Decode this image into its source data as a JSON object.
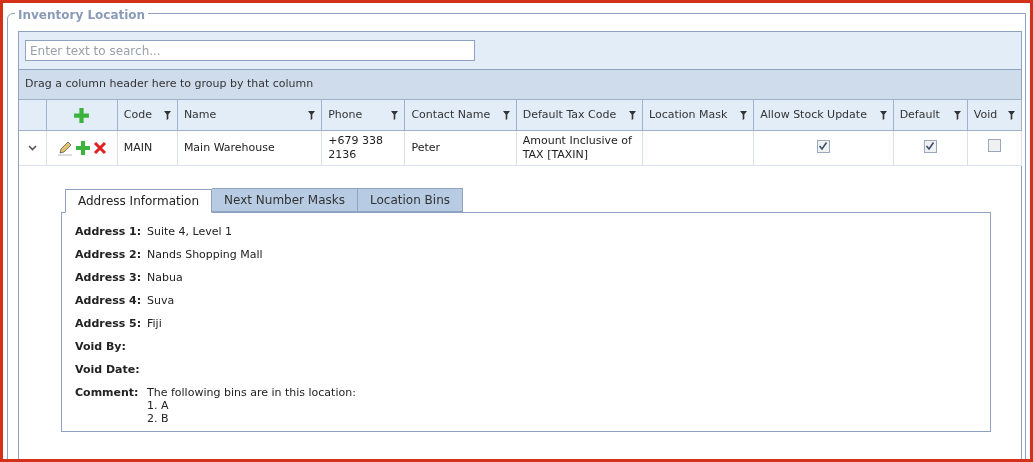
{
  "panel": {
    "title": "Inventory Location"
  },
  "search": {
    "placeholder": "Enter text to search..."
  },
  "group_panel": {
    "text": "Drag a column header here to group by that column"
  },
  "table": {
    "columns": [
      {
        "label": "Code"
      },
      {
        "label": "Name"
      },
      {
        "label": "Phone"
      },
      {
        "label": "Contact Name"
      },
      {
        "label": "Default Tax Code"
      },
      {
        "label": "Location Mask"
      },
      {
        "label": "Allow Stock Update"
      },
      {
        "label": "Default"
      },
      {
        "label": "Void"
      }
    ],
    "rows": [
      {
        "expanded": true,
        "code": "MAIN",
        "name": "Main Warehouse",
        "phone": "+679 338 2136",
        "contact_name": "Peter",
        "default_tax_code": "Amount Inclusive of TAX [TAXIN]",
        "allow_stock_update": true,
        "default": true,
        "void": false
      }
    ]
  },
  "detail": {
    "tabs": [
      {
        "label": "Address Information",
        "selected": true
      },
      {
        "label": "Next Number Masks",
        "selected": false
      },
      {
        "label": "Location Bins",
        "selected": false
      }
    ],
    "fields": [
      {
        "label": "Address 1:",
        "value": "Suite 4, Level 1"
      },
      {
        "label": "Address 2:",
        "value": "Nands Shopping Mall"
      },
      {
        "label": "Address 3:",
        "value": "Nabua"
      },
      {
        "label": "Address 4:",
        "value": "Suva"
      },
      {
        "label": "Address 5:",
        "value": "Fiji"
      },
      {
        "label": "Void By:"
      },
      {
        "label": "Void Date:"
      },
      {
        "label": "Comment:",
        "lines": [
          "The following bins are in this location:",
          "1. A",
          "2. B"
        ]
      }
    ]
  }
}
